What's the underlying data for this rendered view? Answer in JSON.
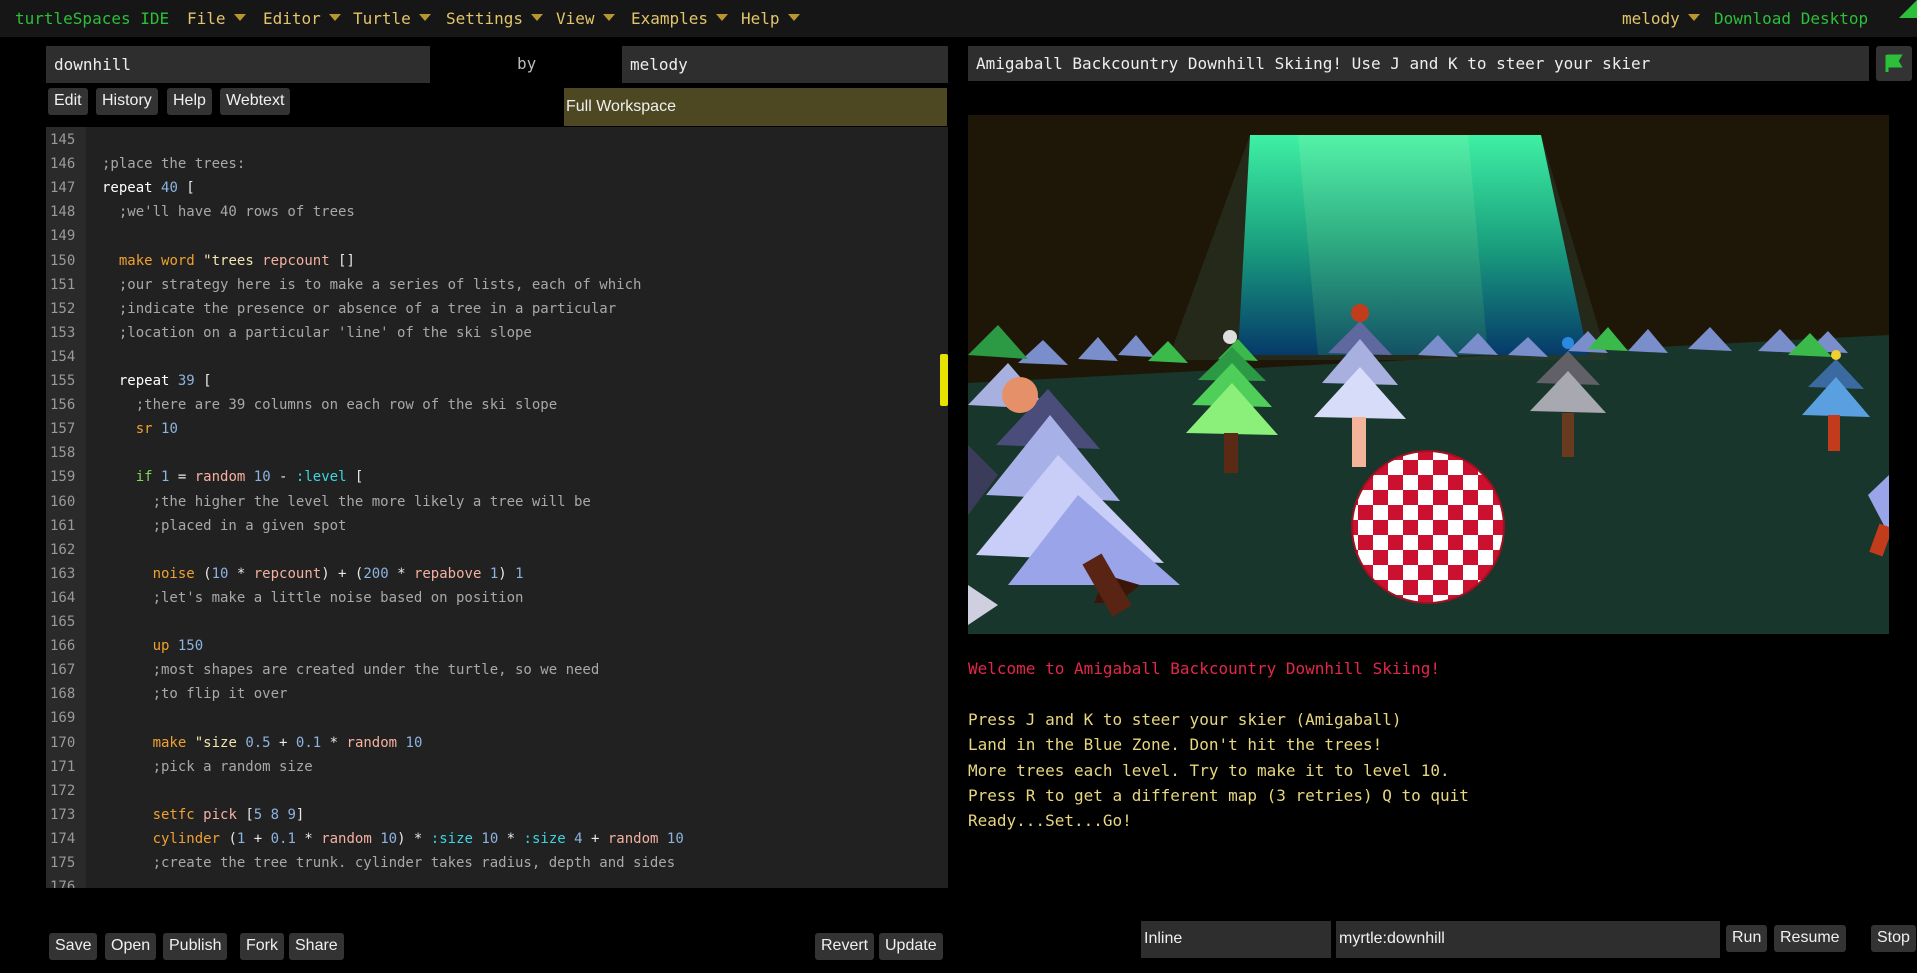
{
  "menubar": {
    "brand": "turtleSpaces IDE",
    "items": [
      "File",
      "Editor",
      "Turtle",
      "Settings",
      "View",
      "Examples",
      "Help"
    ],
    "user": "melody",
    "download": "Download Desktop"
  },
  "project": {
    "name": "downhill",
    "by": "by",
    "author": "melody"
  },
  "editor_tabs": [
    "Edit",
    "History",
    "Help",
    "Webtext"
  ],
  "full_workspace": "Full Workspace",
  "code_lines": [
    {
      "n": "145",
      "tokens": []
    },
    {
      "n": "146",
      "tokens": [
        [
          "comment",
          ";place the trees:"
        ]
      ]
    },
    {
      "n": "147",
      "tokens": [
        [
          "kw",
          "repeat "
        ],
        [
          "num",
          "40"
        ],
        [
          "plain",
          " ["
        ]
      ]
    },
    {
      "n": "148",
      "tokens": [
        [
          "comment",
          "  ;we'll have 40 rows of trees"
        ]
      ]
    },
    {
      "n": "149",
      "tokens": []
    },
    {
      "n": "150",
      "tokens": [
        [
          "plain",
          "  "
        ],
        [
          "cmd",
          "make"
        ],
        [
          "plain",
          " "
        ],
        [
          "cmd",
          "word"
        ],
        [
          "plain",
          " "
        ],
        [
          "str",
          "\"trees"
        ],
        [
          "plain",
          " "
        ],
        [
          "fn",
          "repcount"
        ],
        [
          "plain",
          " []"
        ]
      ]
    },
    {
      "n": "151",
      "tokens": [
        [
          "comment",
          "  ;our strategy here is to make a series of lists, each of which"
        ]
      ]
    },
    {
      "n": "152",
      "tokens": [
        [
          "comment",
          "  ;indicate the presence or absence of a tree in a particular"
        ]
      ]
    },
    {
      "n": "153",
      "tokens": [
        [
          "comment",
          "  ;location on a particular 'line' of the ski slope"
        ]
      ]
    },
    {
      "n": "154",
      "tokens": []
    },
    {
      "n": "155",
      "tokens": [
        [
          "plain",
          "  "
        ],
        [
          "kw",
          "repeat "
        ],
        [
          "num",
          "39"
        ],
        [
          "plain",
          " ["
        ]
      ]
    },
    {
      "n": "156",
      "tokens": [
        [
          "comment",
          "    ;there are 39 columns on each row of the ski slope"
        ]
      ]
    },
    {
      "n": "157",
      "tokens": [
        [
          "plain",
          "    "
        ],
        [
          "cmd",
          "sr"
        ],
        [
          "plain",
          " "
        ],
        [
          "num",
          "10"
        ]
      ]
    },
    {
      "n": "158",
      "tokens": []
    },
    {
      "n": "159",
      "tokens": [
        [
          "plain",
          "    "
        ],
        [
          "ctrl",
          "if"
        ],
        [
          "plain",
          " "
        ],
        [
          "num",
          "1"
        ],
        [
          "plain",
          " = "
        ],
        [
          "fn",
          "random"
        ],
        [
          "plain",
          " "
        ],
        [
          "num",
          "10"
        ],
        [
          "plain",
          " - "
        ],
        [
          "var",
          ":level"
        ],
        [
          "plain",
          " ["
        ]
      ]
    },
    {
      "n": "160",
      "tokens": [
        [
          "comment",
          "      ;the higher the level the more likely a tree will be"
        ]
      ]
    },
    {
      "n": "161",
      "tokens": [
        [
          "comment",
          "      ;placed in a given spot"
        ]
      ]
    },
    {
      "n": "162",
      "tokens": []
    },
    {
      "n": "163",
      "tokens": [
        [
          "plain",
          "      "
        ],
        [
          "cmd",
          "noise"
        ],
        [
          "plain",
          " ("
        ],
        [
          "num",
          "10"
        ],
        [
          "plain",
          " * "
        ],
        [
          "fn",
          "repcount"
        ],
        [
          "plain",
          ") + ("
        ],
        [
          "num",
          "200"
        ],
        [
          "plain",
          " * "
        ],
        [
          "fn",
          "repabove"
        ],
        [
          "plain",
          " "
        ],
        [
          "num",
          "1"
        ],
        [
          "plain",
          ") "
        ],
        [
          "num",
          "1"
        ]
      ]
    },
    {
      "n": "164",
      "tokens": [
        [
          "comment",
          "      ;let's make a little noise based on position"
        ]
      ]
    },
    {
      "n": "165",
      "tokens": []
    },
    {
      "n": "166",
      "tokens": [
        [
          "plain",
          "      "
        ],
        [
          "cmd",
          "up"
        ],
        [
          "plain",
          " "
        ],
        [
          "num",
          "150"
        ]
      ]
    },
    {
      "n": "167",
      "tokens": [
        [
          "comment",
          "      ;most shapes are created under the turtle, so we need"
        ]
      ]
    },
    {
      "n": "168",
      "tokens": [
        [
          "comment",
          "      ;to flip it over"
        ]
      ]
    },
    {
      "n": "169",
      "tokens": []
    },
    {
      "n": "170",
      "tokens": [
        [
          "plain",
          "      "
        ],
        [
          "cmd",
          "make"
        ],
        [
          "plain",
          " "
        ],
        [
          "str",
          "\"size"
        ],
        [
          "plain",
          " "
        ],
        [
          "num",
          "0.5"
        ],
        [
          "plain",
          " + "
        ],
        [
          "num",
          "0.1"
        ],
        [
          "plain",
          " * "
        ],
        [
          "fn",
          "random"
        ],
        [
          "plain",
          " "
        ],
        [
          "num",
          "10"
        ]
      ]
    },
    {
      "n": "171",
      "tokens": [
        [
          "comment",
          "      ;pick a random size"
        ]
      ]
    },
    {
      "n": "172",
      "tokens": []
    },
    {
      "n": "173",
      "tokens": [
        [
          "plain",
          "      "
        ],
        [
          "cmd",
          "setfc"
        ],
        [
          "plain",
          " "
        ],
        [
          "fn",
          "pick"
        ],
        [
          "plain",
          " ["
        ],
        [
          "num",
          "5 8 9"
        ],
        [
          "plain",
          "]"
        ]
      ]
    },
    {
      "n": "174",
      "tokens": [
        [
          "plain",
          "      "
        ],
        [
          "cmd",
          "cylinder"
        ],
        [
          "plain",
          " ("
        ],
        [
          "num",
          "1"
        ],
        [
          "plain",
          " + "
        ],
        [
          "num",
          "0.1"
        ],
        [
          "plain",
          " * "
        ],
        [
          "fn",
          "random"
        ],
        [
          "plain",
          " "
        ],
        [
          "num",
          "10"
        ],
        [
          "plain",
          ") * "
        ],
        [
          "var",
          ":size"
        ],
        [
          "plain",
          " "
        ],
        [
          "num",
          "10"
        ],
        [
          "plain",
          " * "
        ],
        [
          "var",
          ":size"
        ],
        [
          "plain",
          " "
        ],
        [
          "num",
          "4"
        ],
        [
          "plain",
          " + "
        ],
        [
          "fn",
          "random"
        ],
        [
          "plain",
          " "
        ],
        [
          "num",
          "10"
        ]
      ]
    },
    {
      "n": "175",
      "tokens": [
        [
          "comment",
          "      ;create the tree trunk. cylinder takes radius, depth and sides"
        ]
      ]
    },
    {
      "n": "176",
      "tokens": []
    }
  ],
  "bottom_left_buttons": [
    "Save",
    "Open",
    "Publish",
    "Fork",
    "Share"
  ],
  "bottom_edit_buttons": [
    "Revert",
    "Update"
  ],
  "title_text": "Amigaball Backcountry Downhill Skiing! Use J and K to steer your skier",
  "console_lines": [
    {
      "text": "Welcome to Amigaball Backcountry Downhill Skiing!",
      "color": "#e2284a"
    },
    {
      "text": "",
      "color": "#e7d77e"
    },
    {
      "text": "Press J and K to steer your skier (Amigaball)",
      "color": "#e7d77e"
    },
    {
      "text": "Land in the Blue Zone. Don't hit the trees!",
      "color": "#e7d77e"
    },
    {
      "text": "More trees each level. Try to make it to level 10.",
      "color": "#e7d77e"
    },
    {
      "text": "Press R to get a different map (3 retries) Q to quit",
      "color": "#e7d77e"
    },
    {
      "text": "Ready...Set...Go!",
      "color": "#e7d77e"
    }
  ],
  "run_bar": {
    "mode": "Inline",
    "target": "myrtle:downhill",
    "buttons": [
      "Run",
      "Resume",
      "Stop"
    ]
  },
  "colors": {
    "brand_green": "#2bbf3a",
    "menu_yellow": "#e2c46a",
    "console_red": "#e2284a",
    "console_yellow": "#e7d77e",
    "scroll_thumb": "#e8e200",
    "workspace_bg": "#4d4821"
  }
}
